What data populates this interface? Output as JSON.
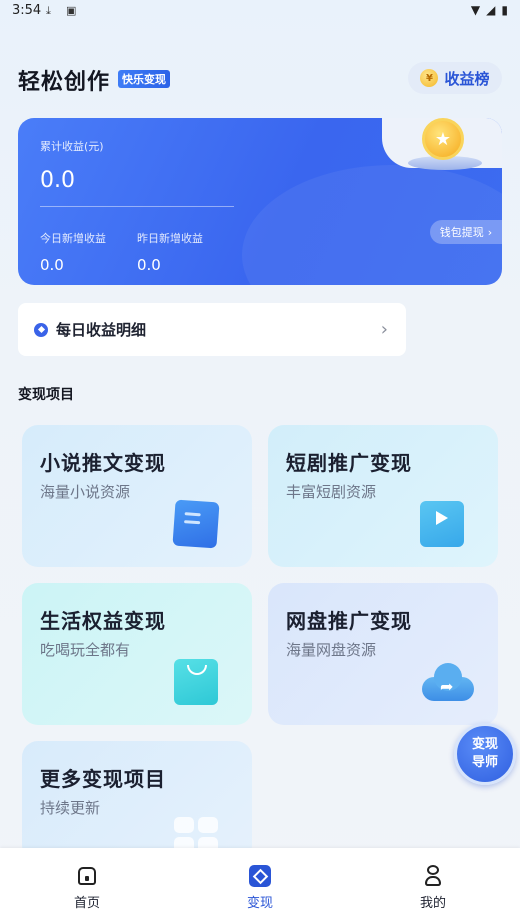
{
  "status_bar": {
    "time": "3:54",
    "left_icons": [
      "download-icon",
      "notification-icon"
    ],
    "right_icons": [
      "wifi-icon",
      "signal-icon",
      "battery-icon"
    ]
  },
  "header": {
    "brand": "轻松创作",
    "brand_tag": "快乐变现",
    "rank_button": "收益榜",
    "rank_icon": "yen-coin-icon"
  },
  "earnings_card": {
    "total_label": "累计收益(元)",
    "total_value": "0.0",
    "today_label": "今日新增收益",
    "today_value": "0.0",
    "yesterday_label": "昨日新增收益",
    "yesterday_value": "0.0",
    "withdraw_button": "钱包提现",
    "accent_color": "#3a66ef"
  },
  "daily_detail": {
    "label": "每日收益明细"
  },
  "projects": {
    "section_title": "变现项目",
    "items": [
      {
        "title": "小说推文变现",
        "subtitle": "海量小说资源",
        "icon": "book-icon"
      },
      {
        "title": "短剧推广变现",
        "subtitle": "丰富短剧资源",
        "icon": "video-play-icon"
      },
      {
        "title": "生活权益变现",
        "subtitle": "吃喝玩全都有",
        "icon": "shopping-bag-icon"
      },
      {
        "title": "网盘推广变现",
        "subtitle": "海量网盘资源",
        "icon": "cloud-share-icon"
      },
      {
        "title": "更多变现项目",
        "subtitle": "持续更新",
        "icon": "grid-apps-icon"
      }
    ]
  },
  "floating_guide": {
    "line1": "变现",
    "line2": "导师"
  },
  "tab_bar": {
    "tabs": [
      {
        "label": "首页",
        "icon": "home-icon"
      },
      {
        "label": "变现",
        "icon": "monetize-icon",
        "active": true
      },
      {
        "label": "我的",
        "icon": "profile-icon"
      }
    ],
    "active_color": "#2a55d6"
  }
}
